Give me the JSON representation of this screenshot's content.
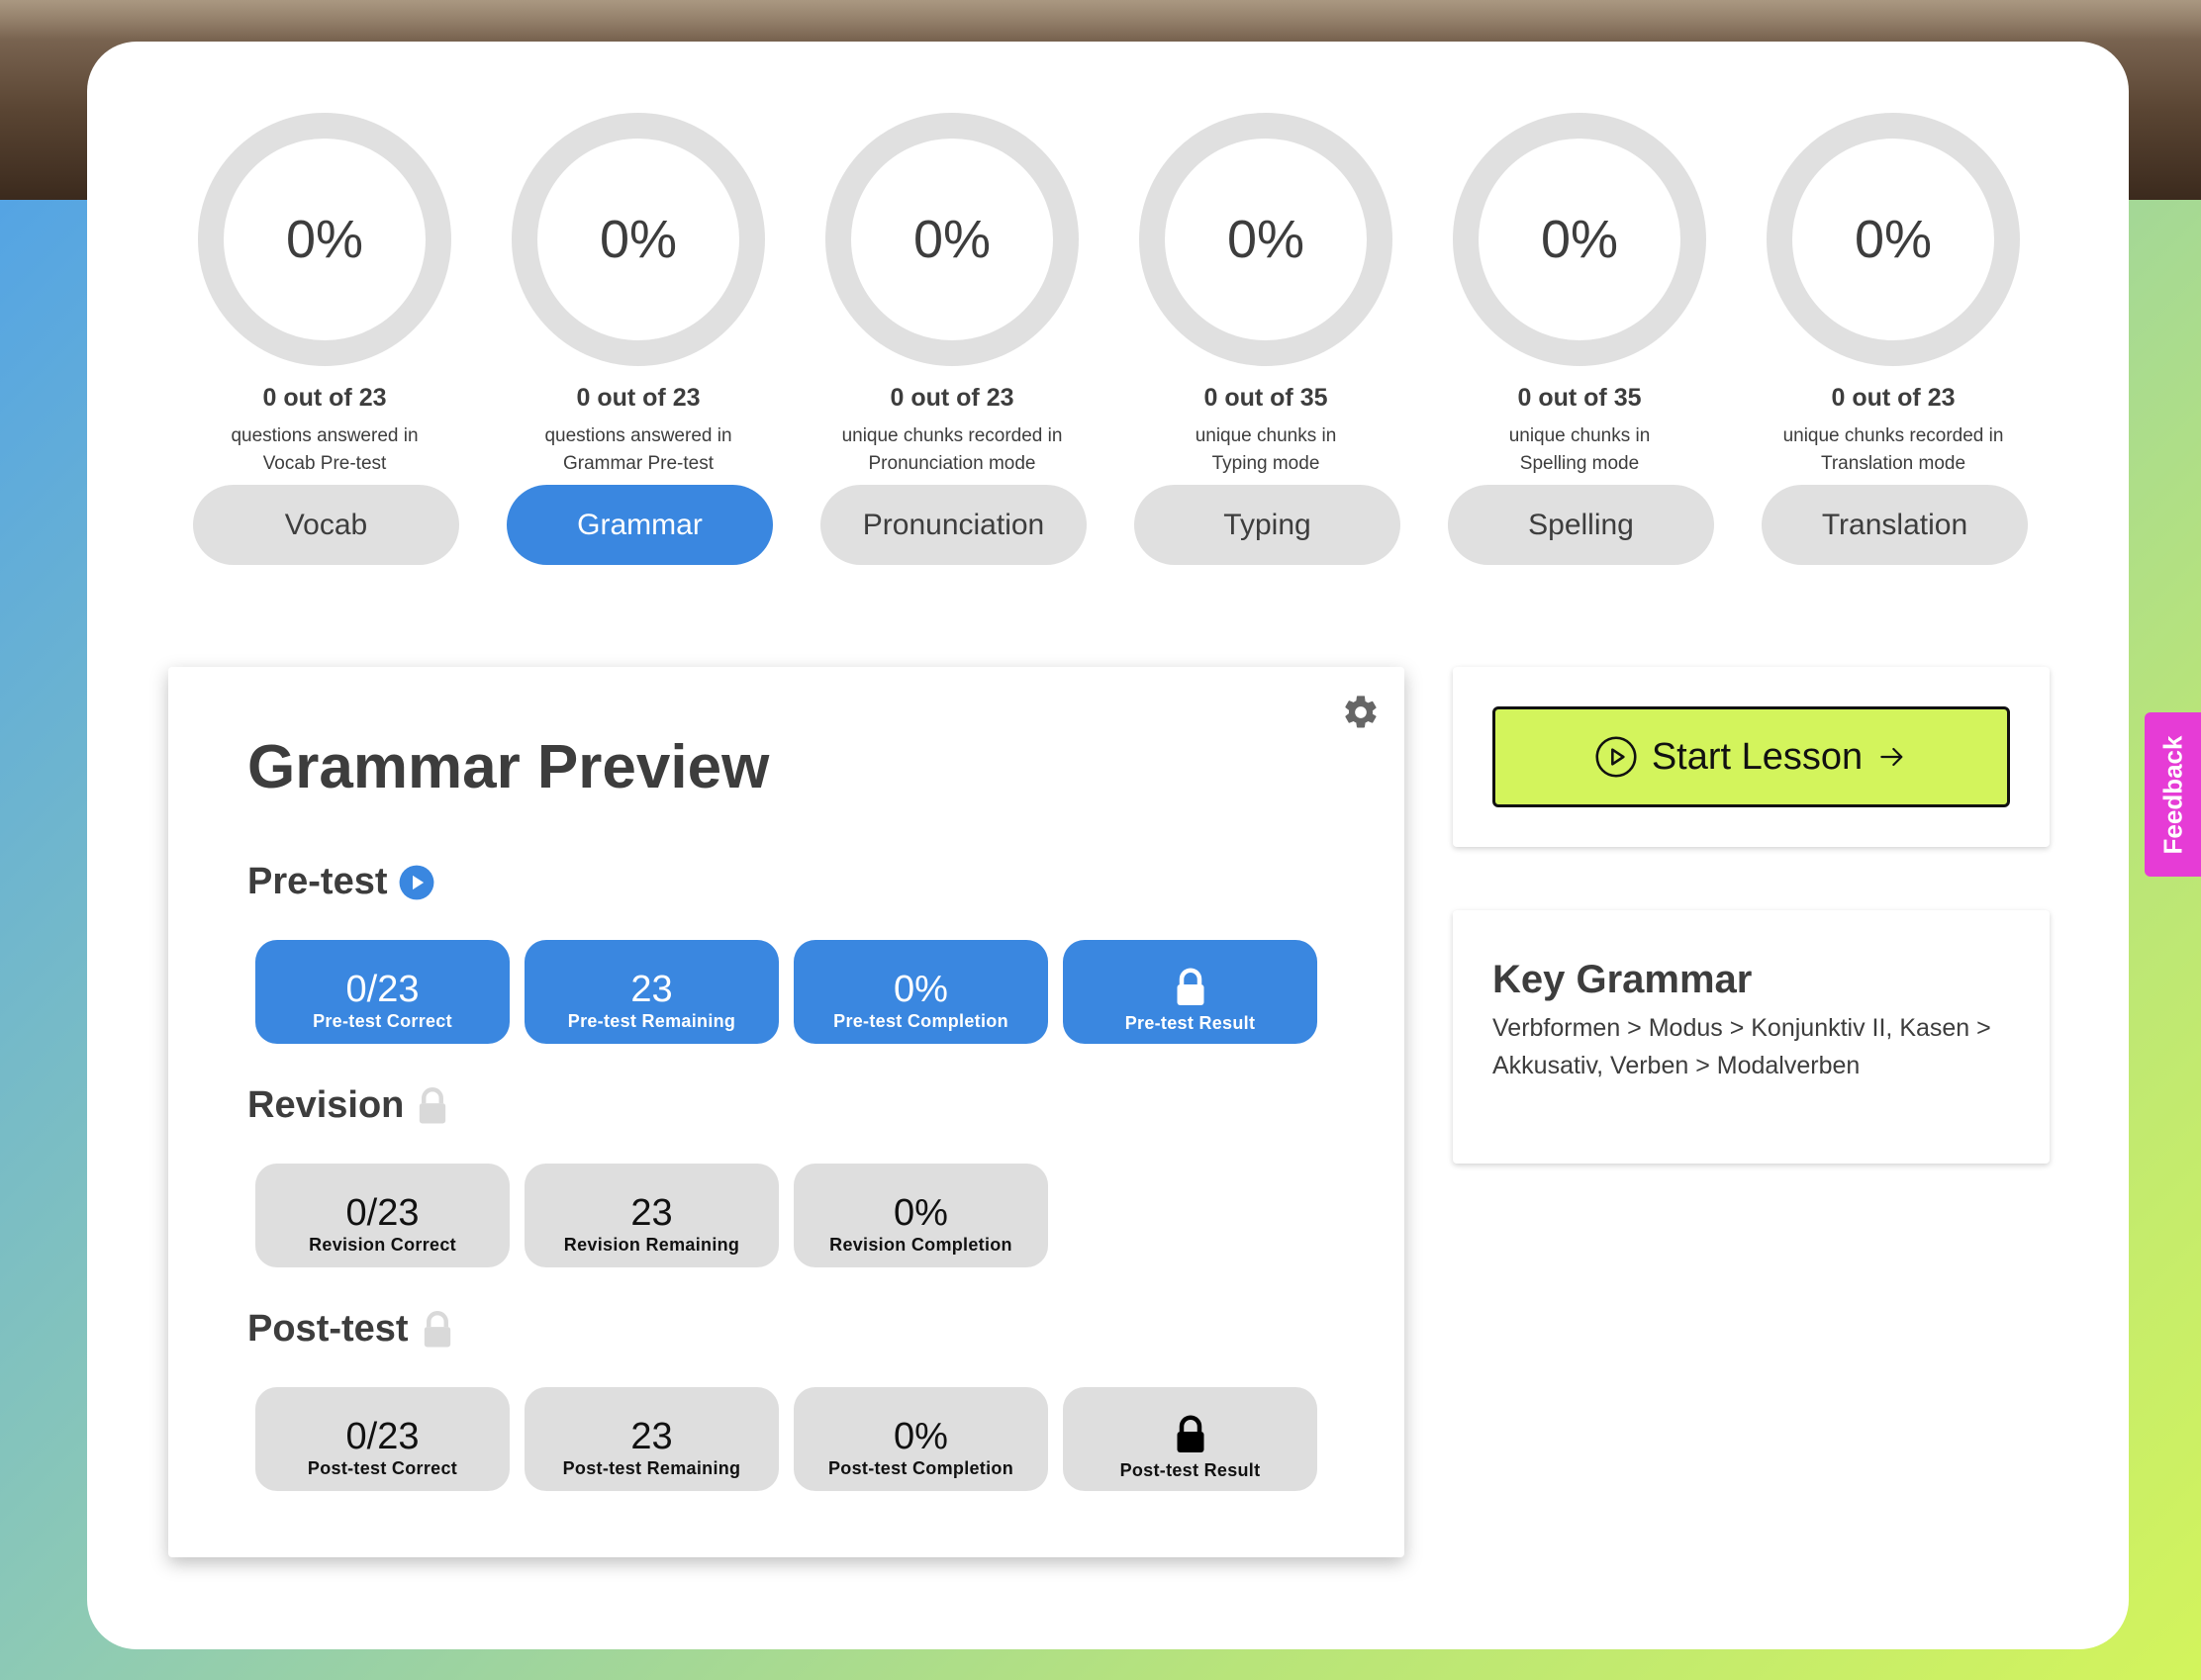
{
  "progress": [
    {
      "percent": "0%",
      "count": "0 out of 23",
      "desc1": "questions answered in",
      "desc2": "Vocab Pre-test",
      "button": "Vocab"
    },
    {
      "percent": "0%",
      "count": "0 out of 23",
      "desc1": "questions answered in",
      "desc2": "Grammar Pre-test",
      "button": "Grammar"
    },
    {
      "percent": "0%",
      "count": "0 out of 23",
      "desc1": "unique chunks recorded in",
      "desc2": "Pronunciation mode",
      "button": "Pronunciation"
    },
    {
      "percent": "0%",
      "count": "0 out of 35",
      "desc1": "unique chunks in",
      "desc2": "Typing mode",
      "button": "Typing"
    },
    {
      "percent": "0%",
      "count": "0 out of 35",
      "desc1": "unique chunks in",
      "desc2": "Spelling mode",
      "button": "Spelling"
    },
    {
      "percent": "0%",
      "count": "0 out of 23",
      "desc1": "unique chunks recorded in",
      "desc2": "Translation mode",
      "button": "Translation"
    }
  ],
  "active_mode": "Grammar",
  "preview": {
    "title": "Grammar Preview",
    "pretest": {
      "heading": "Pre-test",
      "stats": [
        {
          "value": "0/23",
          "label": "Pre-test Correct"
        },
        {
          "value": "23",
          "label": "Pre-test Remaining"
        },
        {
          "value": "0%",
          "label": "Pre-test Completion"
        },
        {
          "value": "",
          "label": "Pre-test Result"
        }
      ]
    },
    "revision": {
      "heading": "Revision",
      "stats": [
        {
          "value": "0/23",
          "label": "Revision Correct"
        },
        {
          "value": "23",
          "label": "Revision Remaining"
        },
        {
          "value": "0%",
          "label": "Revision Completion"
        }
      ]
    },
    "posttest": {
      "heading": "Post-test",
      "stats": [
        {
          "value": "0/23",
          "label": "Post-test Correct"
        },
        {
          "value": "23",
          "label": "Post-test Remaining"
        },
        {
          "value": "0%",
          "label": "Post-test Completion"
        },
        {
          "value": "",
          "label": "Post-test Result"
        }
      ]
    }
  },
  "start_lesson": {
    "label": "Start Lesson"
  },
  "key_grammar": {
    "title": "Key Grammar",
    "body": "Verbformen > Modus > Konjunktiv II, Kasen > Akkusativ, Verben > Modalverben"
  },
  "feedback": {
    "label": "Feedback"
  },
  "colors": {
    "accent_blue": "#3a87e0",
    "start_green": "#d3f45c",
    "feedback_pink": "#e63cd6"
  }
}
